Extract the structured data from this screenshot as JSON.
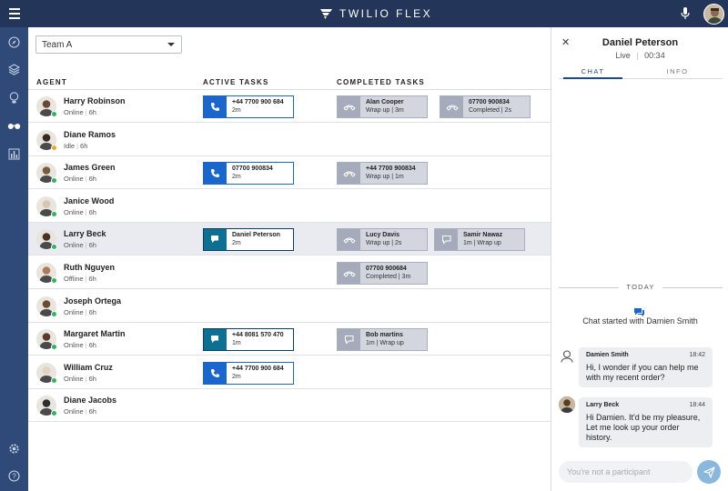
{
  "app": {
    "brand": "TWILIO FLEX"
  },
  "team_select": {
    "value": "Team A"
  },
  "columns": {
    "agent": "AGENT",
    "active": "ACTIVE TASKS",
    "completed": "COMPLETED TASKS"
  },
  "agents": [
    {
      "name": "Harry Robinson",
      "status": "Online",
      "duration": "6h",
      "dot": "#2fb55e",
      "active": [
        {
          "type": "voice",
          "title": "+44 7700 900 684",
          "sub": "2m"
        }
      ],
      "completed": [
        {
          "type": "voice",
          "title": "Alan Cooper",
          "sub": "Wrap up | 3m"
        },
        {
          "type": "voice",
          "title": "07700 900834",
          "sub": "Completed | 2s"
        }
      ]
    },
    {
      "name": "Diane Ramos",
      "status": "Idle",
      "duration": "6h",
      "dot": "#f0a52c",
      "active": [],
      "completed": []
    },
    {
      "name": "James Green",
      "status": "Online",
      "duration": "6h",
      "dot": "#2fb55e",
      "active": [
        {
          "type": "voice",
          "title": "07700 900834",
          "sub": "2m"
        }
      ],
      "completed": [
        {
          "type": "voice",
          "title": "+44 7700 900834",
          "sub": "Wrap up | 1m"
        }
      ]
    },
    {
      "name": "Janice Wood",
      "status": "Online",
      "duration": "6h",
      "dot": "#2fb55e",
      "active": [],
      "completed": []
    },
    {
      "name": "Larry Beck",
      "status": "Online",
      "duration": "6h",
      "dot": "#2fb55e",
      "selected": true,
      "active": [
        {
          "type": "chat",
          "title": "Daniel Peterson",
          "sub": "2m"
        }
      ],
      "completed": [
        {
          "type": "voice",
          "title": "Lucy Davis",
          "sub": "Wrap up | 2s"
        },
        {
          "type": "chat",
          "title": "Samir Nawaz",
          "sub": "1m | Wrap up"
        }
      ]
    },
    {
      "name": "Ruth Nguyen",
      "status": "Offline",
      "duration": "6h",
      "dot": "#2fb55e",
      "active": [],
      "completed": [
        {
          "type": "voice",
          "title": "07700 900684",
          "sub": "Completed | 3m"
        }
      ]
    },
    {
      "name": "Joseph Ortega",
      "status": "Online",
      "duration": "6h",
      "dot": "#2fb55e",
      "active": [],
      "completed": []
    },
    {
      "name": "Margaret Martin",
      "status": "Online",
      "duration": "6h",
      "dot": "#2fb55e",
      "active": [
        {
          "type": "chat",
          "title": "+44 8081 570 470",
          "sub": "1m"
        }
      ],
      "completed": [
        {
          "type": "chat",
          "title": "Bob martins",
          "sub": "1m | Wrap up"
        }
      ]
    },
    {
      "name": "William Cruz",
      "status": "Online",
      "duration": "6h",
      "dot": "#2fb55e",
      "active": [
        {
          "type": "voice",
          "title": "+44 7700 900 684",
          "sub": "2m"
        }
      ],
      "completed": []
    },
    {
      "name": "Diane Jacobs",
      "status": "Online",
      "duration": "6h",
      "dot": "#2fb55e",
      "active": [],
      "completed": []
    }
  ],
  "panel": {
    "customer": "Daniel Peterson",
    "status": "Live",
    "timer": "00:34",
    "tabs": [
      "CHAT",
      "INFO"
    ],
    "today_label": "TODAY",
    "chat_started": "Chat started with Damien Smith",
    "messages": [
      {
        "author": "Damien Smith",
        "time": "18:42",
        "text": "Hi, I wonder if you can help me with my recent order?"
      },
      {
        "author": "Larry Beck",
        "time": "18:44",
        "text": "Hi Damien. It'd be my pleasure, Let me look up your order history."
      }
    ],
    "input_placeholder": "You're not a participant"
  }
}
